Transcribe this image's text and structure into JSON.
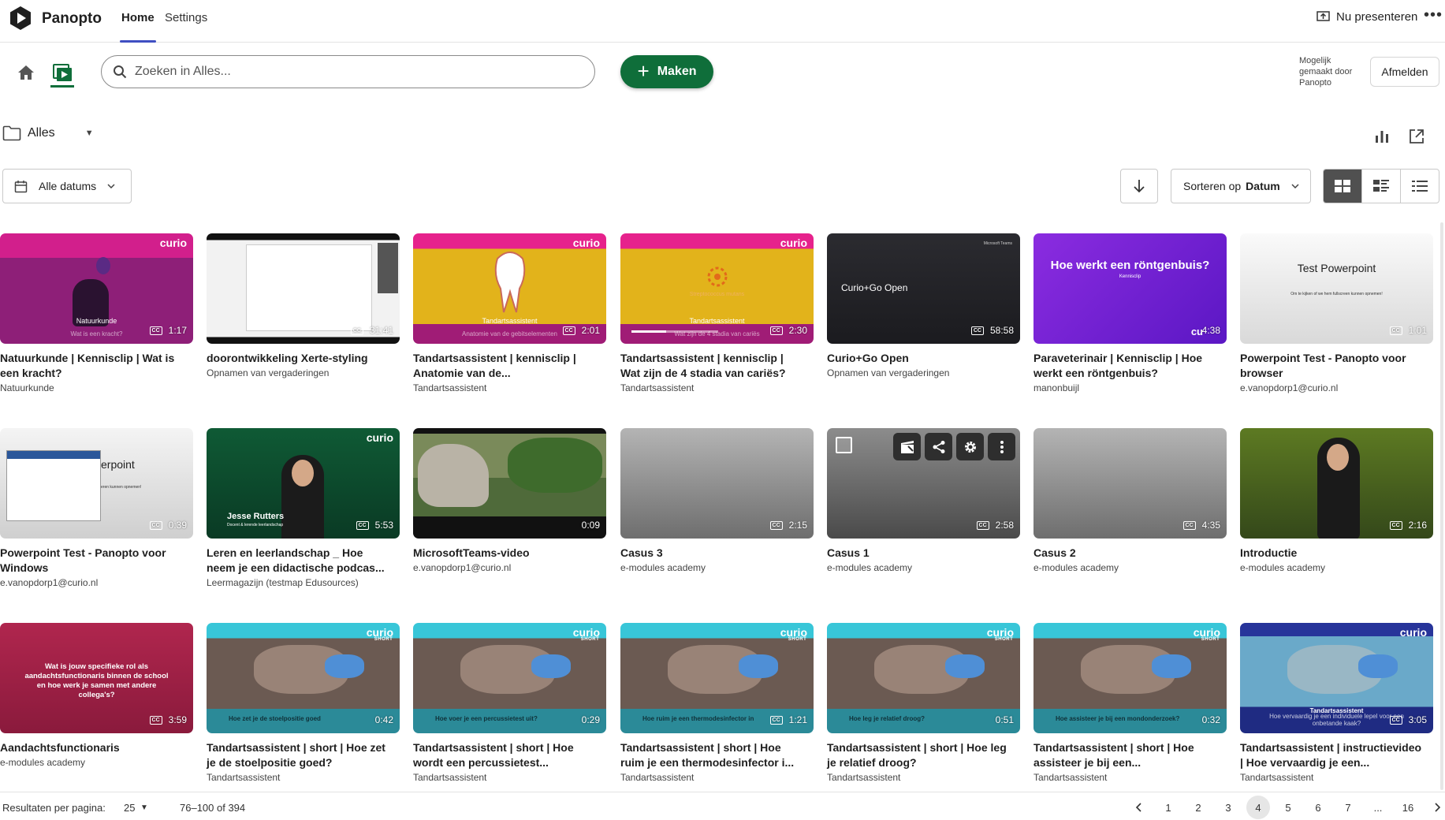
{
  "header": {
    "brand": "Panopto",
    "tabs": [
      {
        "label": "Home",
        "active": true
      },
      {
        "label": "Settings",
        "active": false
      }
    ],
    "present_label": "Nu presenteren",
    "more_icon": "more-horizontal-icon"
  },
  "toolbar": {
    "search_placeholder": "Zoeken in Alles...",
    "create_label": "Maken",
    "powered_by": "Mogelijk gemaakt door Panopto",
    "sign_out_label": "Afmelden"
  },
  "folder": {
    "label": "Alles"
  },
  "filters": {
    "dates_label": "Alle datums",
    "sort_prefix": "Sorteren op",
    "sort_value": "Datum",
    "active_view": "grid"
  },
  "colors": {
    "brand_green": "#0f6e3a",
    "accent_blue": "#3f4fc2"
  },
  "videos": [
    {
      "title": "Natuurkunde | Kennisclip | Wat is een kracht?",
      "sub": "Natuurkunde",
      "duration": "1:17",
      "cc": true,
      "thumb": "curio-pink",
      "caption": "Natuurkunde",
      "caption2": "Wat is een kracht?"
    },
    {
      "title": "doorontwikkeling Xerte-styling",
      "sub": "Opnamen van vergaderingen",
      "duration": "31:41",
      "cc": true,
      "thumb": "screen-share"
    },
    {
      "title": "Tandartsassistent | kennisclip | Anatomie van de...",
      "sub": "Tandartsassistent",
      "duration": "2:01",
      "cc": true,
      "thumb": "curio-tooth",
      "caption": "Tandartsassistent",
      "caption2": "Anatomie van de gebitselementen"
    },
    {
      "title": "Tandartsassistent | kennisclip | Wat zijn de 4 stadia van cariës?",
      "sub": "Tandartsassistent",
      "duration": "2:30",
      "cc": true,
      "thumb": "curio-strep",
      "caption": "Tandartsassistent",
      "caption2": "Wat zijn de 4 stadia van cariës",
      "center_text": "Streptococcus mutans"
    },
    {
      "title": "Curio+Go Open",
      "sub": "Opnamen van vergaderingen",
      "duration": "58:58",
      "cc": true,
      "thumb": "dark-teams",
      "center_text": "Curio+Go Open",
      "corner_text": "Microsoft Teams"
    },
    {
      "title": "Paraveterinair | Kennisclip | Hoe werkt een röntgenbuis?",
      "sub": "manonbuijl",
      "duration": "4:38",
      "cc": false,
      "thumb": "purple",
      "center_text": "Hoe werkt een röntgenbuis?",
      "caption2": "Kennisclip"
    },
    {
      "title": "Powerpoint Test - Panopto voor browser",
      "sub": "e.vanopdorp1@curio.nl",
      "duration": "1:01",
      "cc": true,
      "thumb": "light-ppt",
      "center_text": "Test Powerpoint",
      "caption2": "Om te kijken of we hem fullscreen kunnen opnemen!"
    },
    {
      "title": "Powerpoint Test - Panopto voor Windows",
      "sub": "e.vanopdorp1@curio.nl",
      "duration": "0:39",
      "cc": true,
      "thumb": "ppt-windows",
      "center_text": "erpoint",
      "caption2": "eren kunnen opnemen!"
    },
    {
      "title": "Leren en leerlandschap _ Hoe neem je een didactische podcas...",
      "sub": "Leermagazijn (testmap Edusources)",
      "duration": "5:53",
      "cc": true,
      "thumb": "green-person",
      "caption": "Jesse Rutters",
      "caption2": "Docent & lerende leerlandschap"
    },
    {
      "title": "MicrosoftTeams-video",
      "sub": "e.vanopdorp1@curio.nl",
      "duration": "0:09",
      "cc": false,
      "thumb": "nature"
    },
    {
      "title": "Casus 3",
      "sub": "e-modules academy",
      "duration": "2:15",
      "cc": true,
      "thumb": "gray"
    },
    {
      "title": "Casus 1",
      "sub": "e-modules academy",
      "duration": "2:58",
      "cc": true,
      "thumb": "gray-hover"
    },
    {
      "title": "Casus 2",
      "sub": "e-modules academy",
      "duration": "4:35",
      "cc": true,
      "thumb": "gray"
    },
    {
      "title": "Introductie",
      "sub": "e-modules academy",
      "duration": "2:16",
      "cc": true,
      "thumb": "green-woman"
    },
    {
      "title": "Aandachtsfunctionaris",
      "sub": "e-modules academy",
      "duration": "3:59",
      "cc": true,
      "thumb": "maroon",
      "center_text": "Wat is jouw specifieke rol als aandachtsfunctionaris binnen de school en hoe werk je samen met andere collega's?"
    },
    {
      "title": "Tandartsassistent | short | Hoe zet je de stoelpositie goed?",
      "sub": "Tandartsassistent",
      "duration": "0:42",
      "cc": false,
      "thumb": "short",
      "caption2": "Hoe zet je de stoelpositie goed"
    },
    {
      "title": "Tandartsassistent | short | Hoe wordt een percussietest...",
      "sub": "Tandartsassistent",
      "duration": "0:29",
      "cc": false,
      "thumb": "short",
      "caption2": "Hoe voer je een percussietest uit?"
    },
    {
      "title": "Tandartsassistent | short | Hoe ruim je een thermodesinfector i...",
      "sub": "Tandartsassistent",
      "duration": "1:21",
      "cc": true,
      "thumb": "short",
      "caption2": "Hoe ruim je een thermodesinfector in"
    },
    {
      "title": "Tandartsassistent | short | Hoe leg je relatief droog?",
      "sub": "Tandartsassistent",
      "duration": "0:51",
      "cc": false,
      "thumb": "short",
      "caption2": "Hoe leg je relatief droog?"
    },
    {
      "title": "Tandartsassistent | short | Hoe assisteer je bij een...",
      "sub": "Tandartsassistent",
      "duration": "0:32",
      "cc": false,
      "thumb": "short",
      "caption2": "Hoe assisteer je bij een mondonderzoek?"
    },
    {
      "title": "Tandartsassistent | instructievideo | Hoe vervaardig je een...",
      "sub": "Tandartsassistent",
      "duration": "3:05",
      "cc": true,
      "thumb": "short-blue",
      "caption": "Tandartsassistent",
      "caption2": "Hoe vervaardig je een individuele lepel voor een onbetande kaak?"
    }
  ],
  "brand_badge": "curio",
  "pagination": {
    "per_page_label": "Resultaten per pagina:",
    "per_page": "25",
    "range": "76–100 of 394",
    "pages": [
      "1",
      "2",
      "3",
      "4",
      "5",
      "6",
      "7",
      "...",
      "16"
    ],
    "current": "4"
  }
}
